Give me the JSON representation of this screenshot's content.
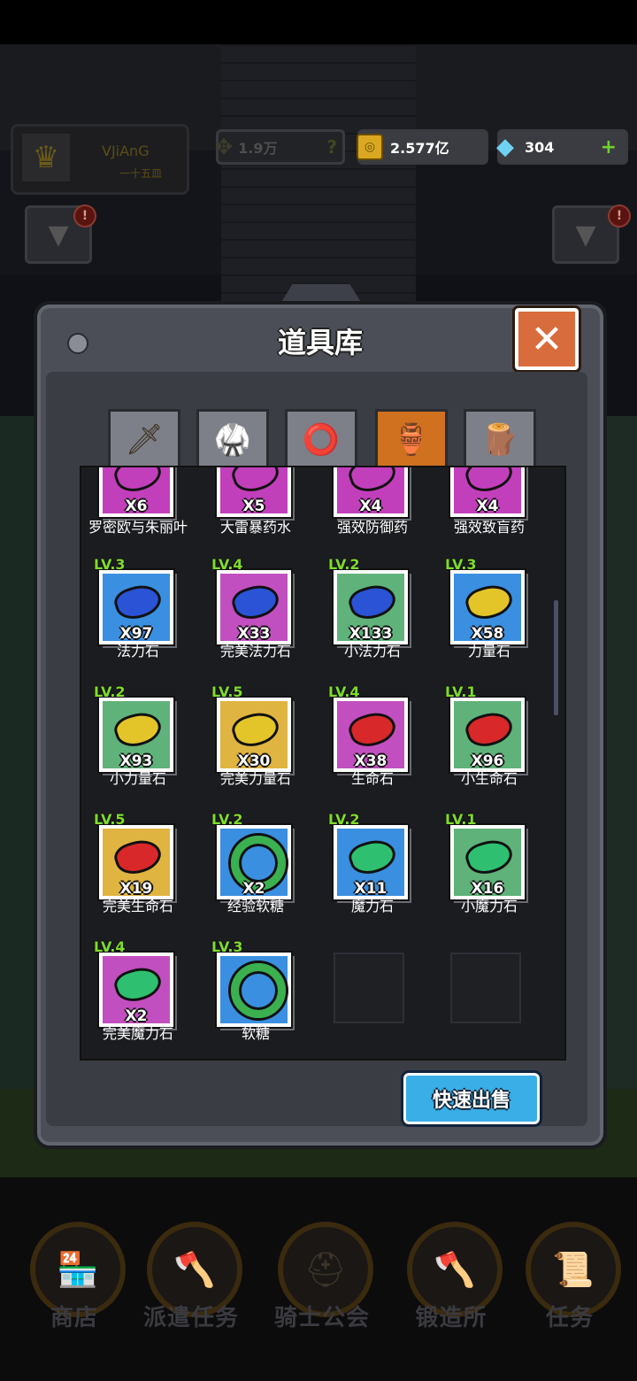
{
  "hud": {
    "player_name": "VJiAnG",
    "player_sub": "一十五皿",
    "power": "1.9万",
    "gold": "2.577亿",
    "gems": "304"
  },
  "dialog": {
    "title": "道具库",
    "tabs": [
      {
        "name": "weapon",
        "icon": "🗡"
      },
      {
        "name": "armor",
        "icon": "🥋"
      },
      {
        "name": "accessory",
        "icon": "⭕"
      },
      {
        "name": "potion",
        "icon": "🏺"
      },
      {
        "name": "material",
        "icon": "🪵"
      }
    ],
    "quick_sell_label": "快速出售",
    "items": [
      {
        "name": "罗密欧与朱丽叶",
        "level": "",
        "count": "X6",
        "color": "#c23fbc",
        "icon": "potion",
        "iconColor": "#c23fbc"
      },
      {
        "name": "大雷暴药水",
        "level": "",
        "count": "X5",
        "color": "#c23fbc",
        "icon": "potion",
        "iconColor": "#c23fbc"
      },
      {
        "name": "强效防御药",
        "level": "",
        "count": "X4",
        "color": "#c23fbc",
        "icon": "potion",
        "iconColor": "#c23fbc"
      },
      {
        "name": "强效致盲药",
        "level": "",
        "count": "X4",
        "color": "#c23fbc",
        "icon": "potion",
        "iconColor": "#c23fbc"
      },
      {
        "name": "法力石",
        "level": "LV.3",
        "count": "X97",
        "color": "#3a8fe0",
        "icon": "gem",
        "iconColor": "#2a53d6"
      },
      {
        "name": "完美法力石",
        "level": "LV.4",
        "count": "X33",
        "color": "#c24fbf",
        "icon": "gem",
        "iconColor": "#2a53d6"
      },
      {
        "name": "小法力石",
        "level": "LV.2",
        "count": "X133",
        "color": "#5fb27a",
        "icon": "gem",
        "iconColor": "#2a53d6"
      },
      {
        "name": "力量石",
        "level": "LV.3",
        "count": "X58",
        "color": "#3a8fe0",
        "icon": "gem",
        "iconColor": "#e3c52a"
      },
      {
        "name": "小力量石",
        "level": "LV.2",
        "count": "X93",
        "color": "#5fb27a",
        "icon": "gem",
        "iconColor": "#e3c52a"
      },
      {
        "name": "完美力量石",
        "level": "LV.5",
        "count": "X30",
        "color": "#e0b440",
        "icon": "gem",
        "iconColor": "#e3c52a"
      },
      {
        "name": "生命石",
        "level": "LV.4",
        "count": "X38",
        "color": "#c24fbf",
        "icon": "gem",
        "iconColor": "#d8282a"
      },
      {
        "name": "小生命石",
        "level": "LV.1",
        "count": "X96",
        "color": "#5fb27a",
        "icon": "gem",
        "iconColor": "#d8282a"
      },
      {
        "name": "完美生命石",
        "level": "LV.5",
        "count": "X19",
        "color": "#e0b440",
        "icon": "gem",
        "iconColor": "#d8282a"
      },
      {
        "name": "经验软糖",
        "level": "LV.2",
        "count": "X2",
        "color": "#3a8fe0",
        "icon": "ring",
        "iconColor": "#3bb04f"
      },
      {
        "name": "魔力石",
        "level": "LV.2",
        "count": "X11",
        "color": "#3a8fe0",
        "icon": "gem",
        "iconColor": "#2ec070"
      },
      {
        "name": "小魔力石",
        "level": "LV.1",
        "count": "X16",
        "color": "#5fb27a",
        "icon": "gem",
        "iconColor": "#2ec070"
      },
      {
        "name": "完美魔力石",
        "level": "LV.4",
        "count": "X2",
        "color": "#c24fbf",
        "icon": "gem",
        "iconColor": "#2ec070"
      },
      {
        "name": "软糖",
        "level": "LV.3",
        "count": "",
        "color": "#3a8fe0",
        "icon": "ring",
        "iconColor": "#3bb04f"
      },
      {
        "name": "",
        "level": "",
        "count": "",
        "color": "",
        "icon": "empty",
        "iconColor": ""
      },
      {
        "name": "",
        "level": "",
        "count": "",
        "color": "",
        "icon": "empty",
        "iconColor": ""
      }
    ]
  },
  "nav": [
    {
      "label": "商店",
      "icon": "🏪"
    },
    {
      "label": "派遣任务",
      "icon": "🪓"
    },
    {
      "label": "骑士公会",
      "icon": "⛑"
    },
    {
      "label": "锻造所",
      "icon": "🪓"
    },
    {
      "label": "任务",
      "icon": "📜"
    }
  ],
  "colors": {
    "accent_orange": "#d0711f",
    "quick_sell_blue": "#3aaee6",
    "panel_gray": "#4b4e56"
  }
}
